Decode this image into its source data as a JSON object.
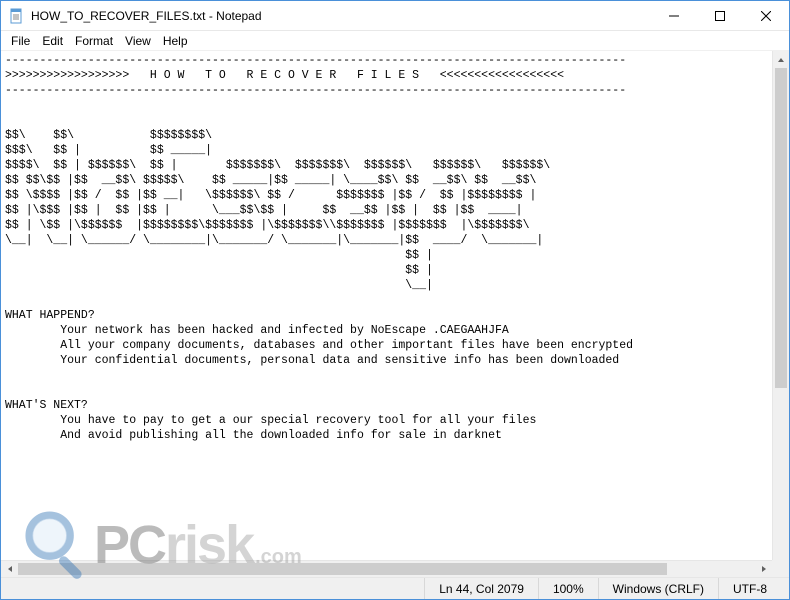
{
  "window": {
    "title": "HOW_TO_RECOVER_FILES.txt - Notepad"
  },
  "menu": {
    "file": "File",
    "edit": "Edit",
    "format": "Format",
    "view": "View",
    "help": "Help"
  },
  "body": "------------------------------------------------------------------------------------------\n>>>>>>>>>>>>>>>>>>   H O W   T O   R E C O V E R   F I L E S   <<<<<<<<<<<<<<<<<<\n------------------------------------------------------------------------------------------\n\n\n$$\\    $$\\           $$$$$$$$\\\n$$$\\   $$ |          $$ _____|\n$$$$\\  $$ | $$$$$$\\  $$ |       $$$$$$$\\  $$$$$$$\\  $$$$$$\\   $$$$$$\\   $$$$$$\\\n$$ $$\\$$ |$$  __$$\\ $$$$$\\    $$ _____|$$ _____| \\____$$\\ $$  __$$\\ $$  __$$\\\n$$ \\$$$$ |$$ /  $$ |$$ __|   \\$$$$$$\\ $$ /      $$$$$$$ |$$ /  $$ |$$$$$$$$ |\n$$ |\\$$$ |$$ |  $$ |$$ |      \\___$$\\$$ |     $$  __$$ |$$ |  $$ |$$  ____|\n$$ | \\$$ |\\$$$$$$  |$$$$$$$$\\$$$$$$$ |\\$$$$$$$\\\\$$$$$$$ |$$$$$$$  |\\$$$$$$$\\\n\\__|  \\__| \\______/ \\________|\\_______/ \\_______|\\_______|$$  ____/  \\_______|\n                                                          $$ |\n                                                          $$ |\n                                                          \\__|\n\nWHAT HAPPEND?\n        Your network has been hacked and infected by NoEscape .CAEGAAHJFA\n        All your company documents, databases and other important files have been encrypted\n        Your confidential documents, personal data and sensitive info has been downloaded\n\n\nWHAT'S NEXT?\n        You have to pay to get a our special recovery tool for all your files\n        And avoid publishing all the downloaded info for sale in darknet\n",
  "status": {
    "position": "Ln 44, Col 2079",
    "zoom": "100%",
    "line_ending": "Windows (CRLF)",
    "encoding": "UTF-8"
  },
  "watermark": {
    "pc": "PC",
    "risk": "risk",
    "com": ".com"
  }
}
